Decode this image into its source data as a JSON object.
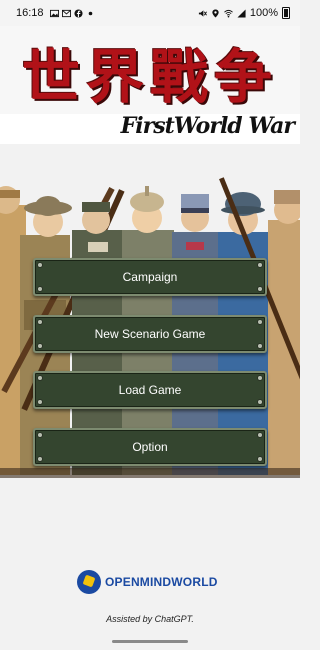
{
  "status_bar": {
    "time": "16:18",
    "left_icons": [
      "image-icon",
      "gmail-icon",
      "facebook-icon",
      "dot-icon"
    ],
    "right_icons": [
      "mute-icon",
      "location-icon",
      "wifi-icon",
      "signal-icon"
    ],
    "battery": "100%"
  },
  "title": {
    "kanji": "世界戰争",
    "subtitle": "FirstWorld War"
  },
  "menu": {
    "campaign": "Campaign",
    "new_scenario": "New Scenario Game",
    "load_game": "Load Game",
    "option": "Option"
  },
  "footer": {
    "logo_text": "OPENMINDWORLD",
    "credit": "Assisted by ChatGPT."
  },
  "colors": {
    "title_red": "#b11218",
    "button_green": "#34452f",
    "logo_blue": "#1b4aa2"
  }
}
